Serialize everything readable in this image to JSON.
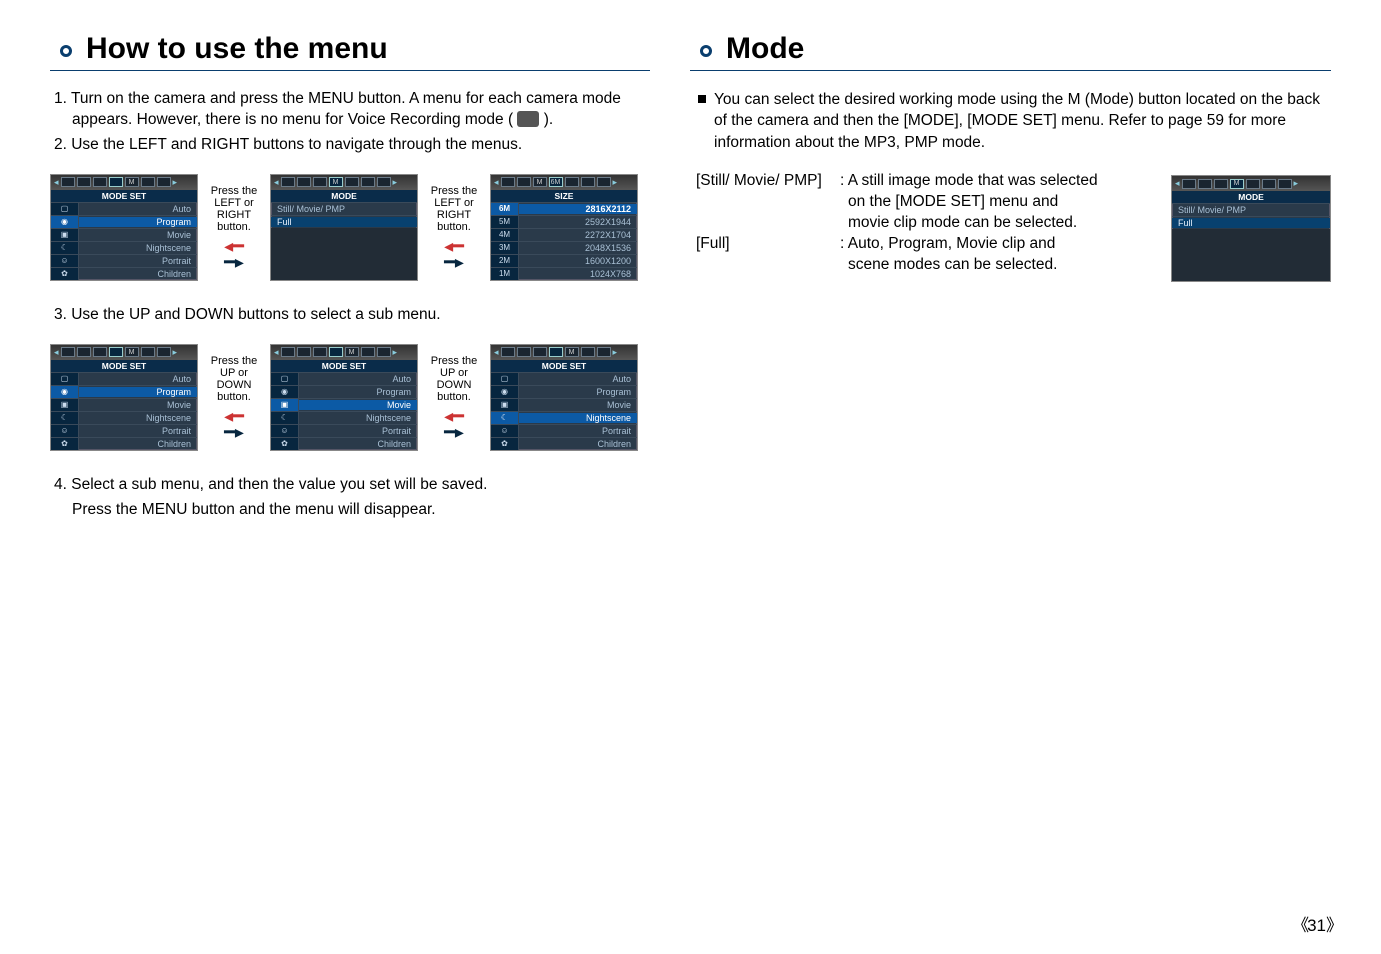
{
  "left": {
    "title": "How to use the menu",
    "steps": {
      "s1": "1. Turn on the camera and press the MENU button. A menu for each camera mode appears. However, there is no menu for Voice Recording mode (",
      "s1_tail": ").",
      "s2": "2. Use the LEFT and RIGHT buttons to navigate through the menus.",
      "s3": "3. Use the UP and DOWN buttons to select a sub menu.",
      "s4a": "4. Select a sub menu, and then the value you set will be saved.",
      "s4b": "Press the MENU button and the menu will disappear."
    },
    "nav1": "Press the LEFT or RIGHT button.",
    "nav2": "Press the UP or DOWN button.",
    "screenA": {
      "banner": "MODE SET",
      "items": [
        "Auto",
        "Program",
        "Movie",
        "Nightscene",
        "Portrait",
        "Children"
      ]
    },
    "screenB": {
      "banner": "MODE",
      "row0": "Still/ Movie/ PMP",
      "row1": "Full"
    },
    "screenC": {
      "banner": "SIZE",
      "rows": [
        {
          "k": "6M",
          "v": "2816X2112"
        },
        {
          "k": "5M",
          "v": "2592X1944"
        },
        {
          "k": "4M",
          "v": "2272X1704"
        },
        {
          "k": "3M",
          "v": "2048X1536"
        },
        {
          "k": "2M",
          "v": "1600X1200"
        },
        {
          "k": "1M",
          "v": "1024X768"
        }
      ]
    }
  },
  "right": {
    "title": "Mode",
    "intro": "You can select the desired working mode using the M (Mode) button located on the back of the camera and then the [MODE], [MODE SET] menu. Refer to page 59 for more information about the MP3, PMP mode.",
    "def1_key": "[Still/ Movie/ PMP]",
    "def1_val_a": ": A still image mode that was selected",
    "def1_val_b": "on the [MODE SET] menu and",
    "def1_val_c": "movie clip mode can be selected.",
    "def2_key": "[Full]",
    "def2_val_a": ": Auto, Program, Movie clip and",
    "def2_val_b": "scene modes can be selected.",
    "screen": {
      "banner": "MODE",
      "row0": "Still/ Movie/ PMP",
      "row1": "Full",
      "tab": "M"
    }
  },
  "page": "31"
}
